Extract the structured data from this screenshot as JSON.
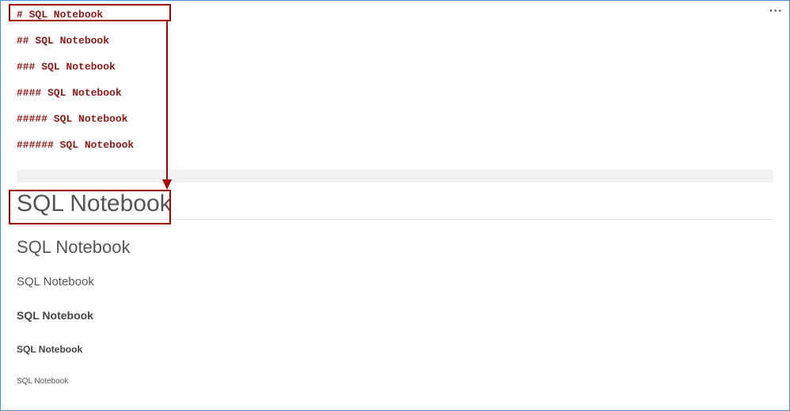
{
  "more_menu": "···",
  "source": {
    "h1": "# SQL Notebook",
    "h2": "## SQL Notebook",
    "h3": "### SQL Notebook",
    "h4": "#### SQL Notebook",
    "h5": "##### SQL Notebook",
    "h6": "###### SQL Notebook"
  },
  "rendered": {
    "h1": "SQL Notebook",
    "h2": "SQL Notebook",
    "h3": "SQL Notebook",
    "h4": "SQL Notebook",
    "h5": "SQL Notebook",
    "h6": "SQL Notebook"
  }
}
